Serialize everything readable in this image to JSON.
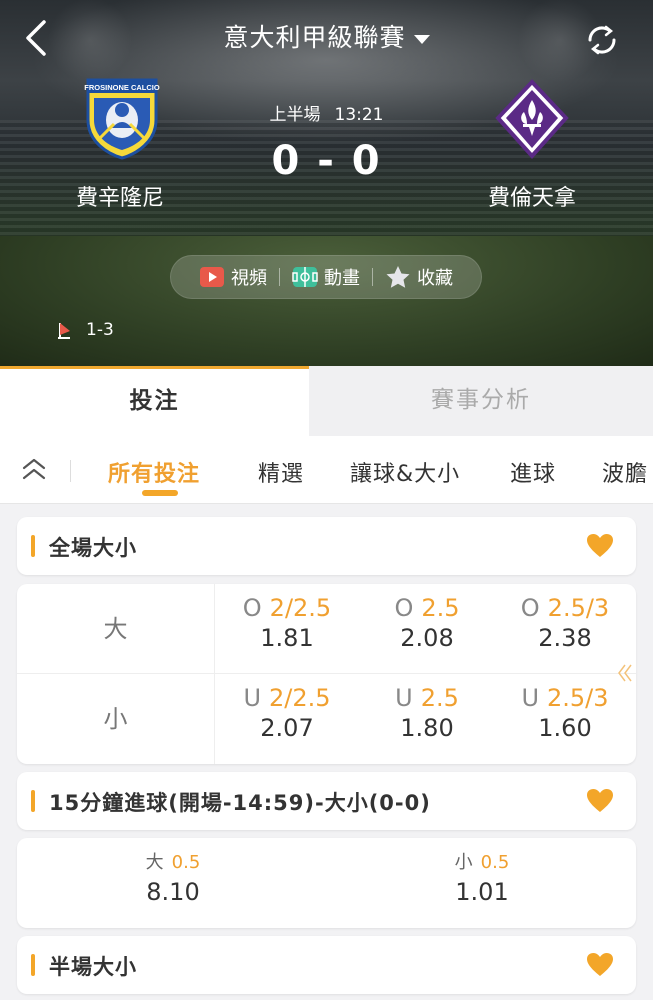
{
  "header": {
    "league_title": "意大利甲級聯賽",
    "home_team": {
      "name": "費辛隆尼",
      "logo_text": "FROSINONE CALCIO"
    },
    "away_team": {
      "name": "費倫天拿"
    },
    "period": "上半場",
    "clock": "13:21",
    "score": "0 - 0",
    "actions": [
      {
        "label": "視頻",
        "icon": "video-icon"
      },
      {
        "label": "動畫",
        "icon": "pitch-animation-icon"
      },
      {
        "label": "收藏",
        "icon": "star-icon"
      }
    ],
    "corner_count": "1-3",
    "colors": {
      "accent": "#f3a629",
      "video_icon": "#e8594a",
      "anim_icon": "#3fbf9b"
    }
  },
  "main_tabs": [
    {
      "label": "投注",
      "active": true
    },
    {
      "label": "賽事分析",
      "active": false
    }
  ],
  "sub_tabs": [
    {
      "label": "所有投注",
      "active": true
    },
    {
      "label": "精選",
      "active": false
    },
    {
      "label": "讓球&大小",
      "active": false
    },
    {
      "label": "進球",
      "active": false
    },
    {
      "label": "波膽",
      "active": false
    }
  ],
  "sections": {
    "full_time_ou": {
      "title": "全場大小",
      "rows": [
        {
          "label": "大",
          "cells": [
            {
              "prefix": "O",
              "line": "2/2.5",
              "odds": "1.81"
            },
            {
              "prefix": "O",
              "line": "2.5",
              "odds": "2.08"
            },
            {
              "prefix": "O",
              "line": "2.5/3",
              "odds": "2.38"
            }
          ]
        },
        {
          "label": "小",
          "cells": [
            {
              "prefix": "U",
              "line": "2/2.5",
              "odds": "2.07"
            },
            {
              "prefix": "U",
              "line": "2.5",
              "odds": "1.80"
            },
            {
              "prefix": "U",
              "line": "2.5/3",
              "odds": "1.60"
            }
          ]
        }
      ]
    },
    "fifteen_min_ou": {
      "title": "15分鐘進球(開場-14:59)-大小(0-0)",
      "cells": [
        {
          "label": "大",
          "line": "0.5",
          "odds": "8.10"
        },
        {
          "label": "小",
          "line": "0.5",
          "odds": "1.01"
        }
      ]
    },
    "half_time_ou": {
      "title": "半場大小"
    }
  }
}
